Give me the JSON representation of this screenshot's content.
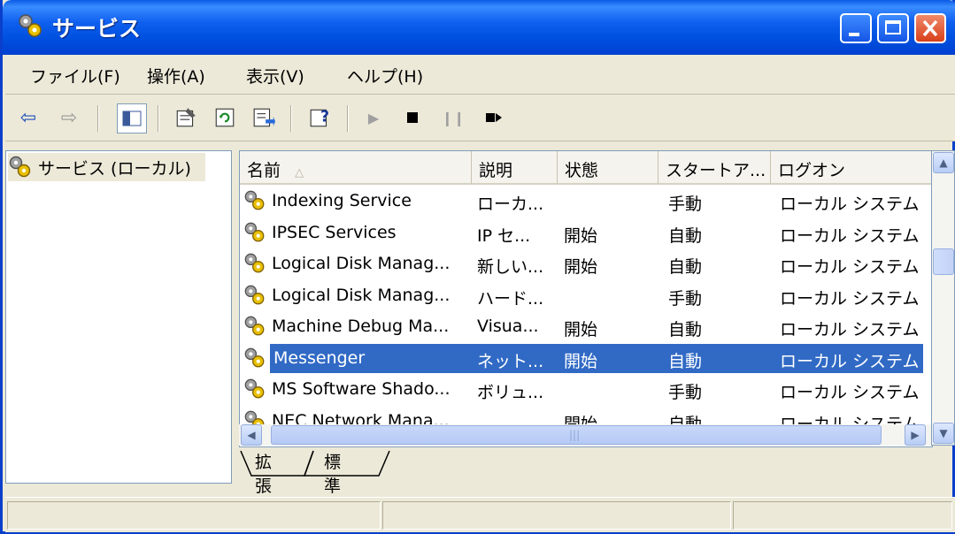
{
  "window": {
    "title": "サービス"
  },
  "menu": [
    "ファイル(F)",
    "操作(A)",
    "表示(V)",
    "ヘルプ(H)"
  ],
  "toolbar": [
    "back-icon",
    "forward-icon",
    "show-hide-tree-icon",
    "properties-icon",
    "refresh-icon",
    "export-list-icon",
    "help-icon",
    "start-service-icon",
    "stop-service-icon",
    "pause-service-icon",
    "restart-service-icon"
  ],
  "tree": {
    "root_label": "サービス (ローカル)"
  },
  "table": {
    "columns": [
      "名前",
      "説明",
      "状態",
      "スタートア...",
      "ログオン"
    ],
    "rows": [
      {
        "name": "Indexing Service",
        "desc": "ローカ...",
        "status": "",
        "startup": "手動",
        "logon": "ローカル システム"
      },
      {
        "name": "IPSEC Services",
        "desc": "IP セ...",
        "status": "開始",
        "startup": "自動",
        "logon": "ローカル システム"
      },
      {
        "name": "Logical Disk Manag...",
        "desc": "新しい...",
        "status": "開始",
        "startup": "自動",
        "logon": "ローカル システム"
      },
      {
        "name": "Logical Disk Manag...",
        "desc": "ハード...",
        "status": "",
        "startup": "手動",
        "logon": "ローカル システム"
      },
      {
        "name": "Machine Debug Ma...",
        "desc": "Visua...",
        "status": "開始",
        "startup": "自動",
        "logon": "ローカル システム"
      },
      {
        "name": "Messenger",
        "desc": "ネット...",
        "status": "開始",
        "startup": "自動",
        "logon": "ローカル システム"
      },
      {
        "name": "MS Software Shado...",
        "desc": "ボリュ...",
        "status": "",
        "startup": "手動",
        "logon": "ローカル システム"
      },
      {
        "name": "NEC Network Mana...",
        "desc": "",
        "status": "開始",
        "startup": "自動",
        "logon": "ローカル システム"
      }
    ]
  },
  "tabs": [
    "拡張",
    "標準"
  ],
  "colors": {
    "titlebar": "#0A5AE6",
    "selection": "#316AC5",
    "chrome": "#ECE9D8"
  }
}
